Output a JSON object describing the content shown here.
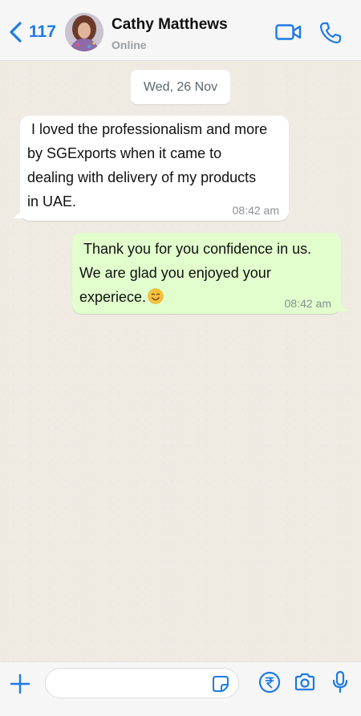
{
  "header": {
    "back_count": "117",
    "contact_name": "Cathy Matthews",
    "status": "Online",
    "icons": [
      "chevron-left-icon",
      "avatar",
      "video-camera-icon",
      "phone-icon"
    ]
  },
  "chat": {
    "date": "Wed, 26 Nov",
    "messages": [
      {
        "direction": "incoming",
        "text": " I loved the professionalism and more\nby SGExports when it came to\ndealing with delivery of my products\nin UAE.",
        "time": "08:42 am"
      },
      {
        "direction": "outgoing",
        "text": " Thank you for you confidence in us.\nWe are glad you enjoyed your\nexperiece.",
        "emoji": "smiling-face-icon",
        "time": "08:42 am"
      }
    ]
  },
  "composer": {
    "input_value": "",
    "icons": [
      "plus-icon",
      "sticker-icon",
      "rupee-icon",
      "camera-icon",
      "microphone-icon"
    ]
  },
  "colors": {
    "accent": "#1d7ae5",
    "chat_background": "#efeae2",
    "incoming_bubble": "#ffffff",
    "outgoing_bubble": "#e1fecc",
    "header_background": "#f6f6f6"
  }
}
